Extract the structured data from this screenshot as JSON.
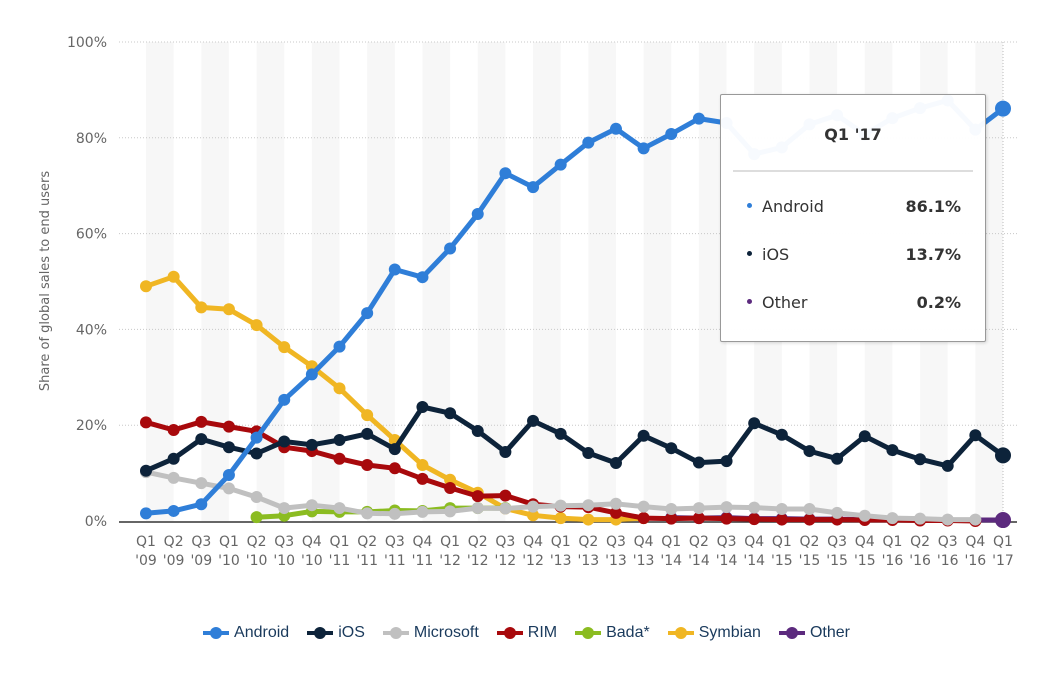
{
  "chart_data": {
    "type": "line",
    "title": "",
    "xlabel": "",
    "ylabel": "Share of global sales to end users",
    "ylim": [
      0,
      100
    ],
    "yticks": [
      "0%",
      "20%",
      "40%",
      "60%",
      "80%",
      "100%"
    ],
    "ytick_values": [
      0,
      20,
      40,
      60,
      80,
      100
    ],
    "grid": true,
    "legend_position": "bottom",
    "categories": [
      [
        "Q1",
        "'09"
      ],
      [
        "Q2",
        "'09"
      ],
      [
        "Q3",
        "'09"
      ],
      [
        "Q1",
        "'10"
      ],
      [
        "Q2",
        "'10"
      ],
      [
        "Q3",
        "'10"
      ],
      [
        "Q4",
        "'10"
      ],
      [
        "Q1",
        "'11"
      ],
      [
        "Q2",
        "'11"
      ],
      [
        "Q3",
        "'11"
      ],
      [
        "Q4",
        "'11"
      ],
      [
        "Q1",
        "'12"
      ],
      [
        "Q2",
        "'12"
      ],
      [
        "Q3",
        "'12"
      ],
      [
        "Q4",
        "'12"
      ],
      [
        "Q1",
        "'13"
      ],
      [
        "Q2",
        "'13"
      ],
      [
        "Q3",
        "'13"
      ],
      [
        "Q4",
        "'13"
      ],
      [
        "Q1",
        "'14"
      ],
      [
        "Q2",
        "'14"
      ],
      [
        "Q3",
        "'14"
      ],
      [
        "Q4",
        "'14"
      ],
      [
        "Q1",
        "'15"
      ],
      [
        "Q2",
        "'15"
      ],
      [
        "Q3",
        "'15"
      ],
      [
        "Q4",
        "'15"
      ],
      [
        "Q1",
        "'16"
      ],
      [
        "Q2",
        "'16"
      ],
      [
        "Q3",
        "'16"
      ],
      [
        "Q4",
        "'16"
      ],
      [
        "Q1",
        "'17"
      ]
    ],
    "series": [
      {
        "name": "Android",
        "color": "#2f7ed8",
        "values": [
          1.6,
          2.1,
          3.5,
          9.6,
          17.4,
          25.3,
          30.6,
          36.4,
          43.4,
          52.5,
          50.9,
          56.9,
          64.1,
          72.6,
          69.7,
          74.4,
          79.0,
          81.9,
          77.8,
          80.8,
          84.0,
          83.1,
          76.6,
          78.0,
          82.8,
          84.7,
          80.7,
          84.1,
          86.2,
          87.8,
          81.7,
          86.1
        ]
      },
      {
        "name": "iOS",
        "color": "#0d233a",
        "values": [
          10.5,
          13.0,
          17.1,
          15.4,
          14.1,
          16.6,
          15.9,
          16.9,
          18.2,
          15.0,
          23.8,
          22.5,
          18.8,
          14.4,
          20.9,
          18.2,
          14.2,
          12.1,
          17.8,
          15.2,
          12.2,
          12.5,
          20.4,
          18.0,
          14.6,
          13.0,
          17.7,
          14.8,
          12.9,
          11.5,
          17.9,
          13.7
        ]
      },
      {
        "name": "Microsoft",
        "color": "#c0c0c0",
        "values": [
          10.2,
          9.0,
          7.9,
          6.8,
          5.0,
          2.7,
          3.3,
          2.7,
          1.6,
          1.5,
          1.9,
          2.0,
          2.7,
          2.6,
          3.0,
          3.2,
          3.3,
          3.6,
          3.0,
          2.5,
          2.7,
          2.9,
          2.8,
          2.5,
          2.5,
          1.7,
          1.1,
          0.6,
          0.5,
          0.3,
          0.3,
          null
        ]
      },
      {
        "name": "RIM",
        "color": "#a8090c",
        "values": [
          20.6,
          19.0,
          20.7,
          19.7,
          18.7,
          15.4,
          14.6,
          13.0,
          11.7,
          11.0,
          8.8,
          6.9,
          5.2,
          5.3,
          3.5,
          3.0,
          2.9,
          1.7,
          0.6,
          0.5,
          0.6,
          0.5,
          0.4,
          0.3,
          0.3,
          0.3,
          0.2,
          0.2,
          0.1,
          0.1,
          0.0,
          null
        ]
      },
      {
        "name": "Bada*",
        "color": "#8bbc21",
        "values": [
          null,
          null,
          null,
          null,
          0.8,
          1.1,
          2.0,
          1.9,
          1.9,
          2.2,
          2.1,
          2.7,
          2.7,
          2.7,
          null,
          null,
          null,
          null,
          null,
          null,
          null,
          null,
          null,
          null,
          null,
          null,
          null,
          null,
          null,
          null,
          null,
          null
        ]
      },
      {
        "name": "Symbian",
        "color": "#f0b623",
        "values": [
          49.0,
          51.0,
          44.6,
          44.2,
          40.9,
          36.3,
          32.3,
          27.7,
          22.1,
          16.9,
          11.7,
          8.6,
          5.9,
          2.6,
          1.2,
          0.6,
          0.3,
          0.3,
          0.6,
          null,
          null,
          null,
          null,
          null,
          null,
          null,
          null,
          null,
          null,
          null,
          null,
          null
        ]
      },
      {
        "name": "Other",
        "color": "#5c2a7e",
        "values": [
          null,
          null,
          null,
          null,
          null,
          null,
          null,
          null,
          null,
          null,
          null,
          null,
          null,
          null,
          null,
          null,
          null,
          null,
          null,
          0.7,
          0.6,
          0.7,
          0.5,
          0.5,
          0.4,
          0.4,
          0.3,
          0.3,
          0.2,
          0.2,
          0.2,
          0.2
        ]
      }
    ],
    "highlighted_index": 31
  },
  "tooltip": {
    "title": "Q1 '17",
    "rows": [
      {
        "label": "Android",
        "value": "86.1%",
        "color": "#2f7ed8"
      },
      {
        "label": "iOS",
        "value": "13.7%",
        "color": "#0d233a"
      },
      {
        "label": "Other",
        "value": "0.2%",
        "color": "#5c2a7e"
      }
    ]
  }
}
